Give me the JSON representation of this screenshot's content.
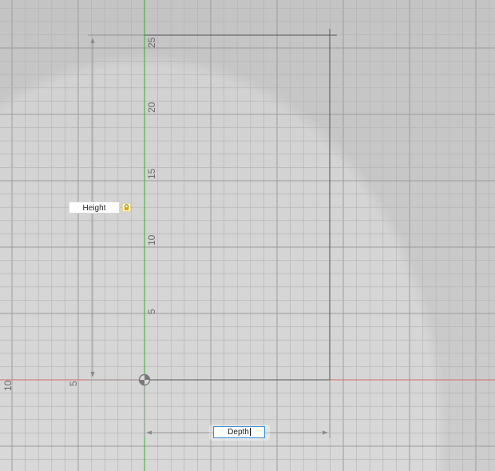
{
  "viewport": {
    "y_axis_ticks": [
      "25",
      "20",
      "15",
      "10",
      "5"
    ],
    "x_axis_ticks": [
      "10",
      "5"
    ]
  },
  "dimensions": {
    "height": {
      "label": "Height",
      "locked": true,
      "lock_icon": "lock-icon"
    },
    "depth": {
      "label": "Depth",
      "active": true
    }
  },
  "colors": {
    "grid_minor": "#b2b2b2",
    "grid_major": "#9c9c9c",
    "axis_x": "#d46a6a",
    "axis_y": "#3aa83a",
    "sketch_line": "#555555",
    "dimension_line": "#8a8a8a",
    "input_focus": "#3d8fd6",
    "lock": "#e3a712"
  }
}
